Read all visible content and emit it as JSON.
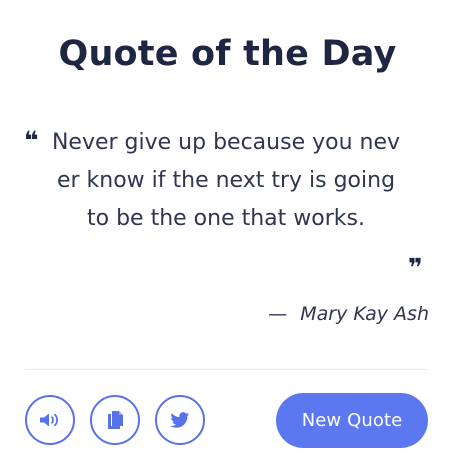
{
  "header": {
    "title": "Quote of the Day"
  },
  "quote": {
    "open_mark": "❝",
    "text": "Never give up because you never know if the next try is going to be the one that works.",
    "close_mark": "❞",
    "author_dash": "—",
    "author": "Mary Kay Ash"
  },
  "actions": {
    "speak_icon": "speaker-icon",
    "copy_icon": "copy-icon",
    "twitter_icon": "twitter-icon",
    "new_quote_label": "New Quote"
  },
  "colors": {
    "accent": "#5872ea",
    "button_bg": "#5c78f1",
    "title": "#1f2641",
    "text": "#303650",
    "divider": "#e5e8ef"
  }
}
